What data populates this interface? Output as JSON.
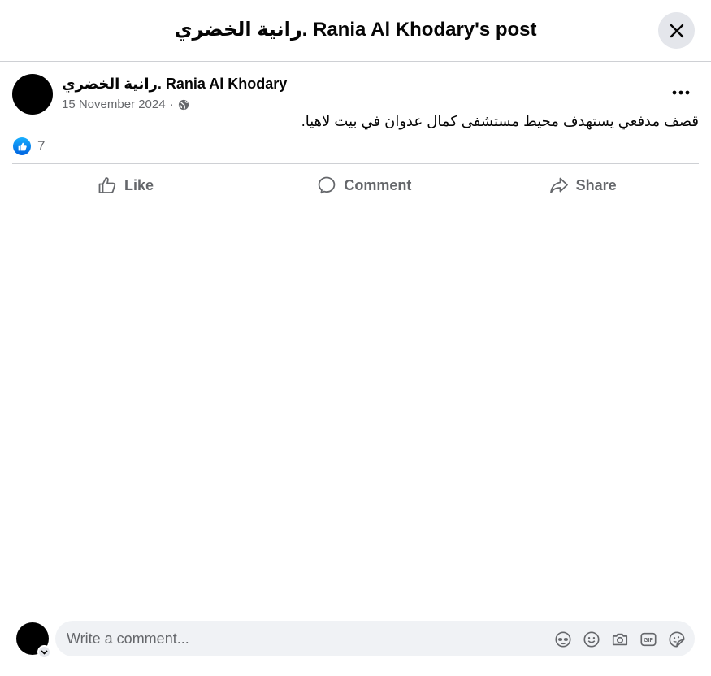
{
  "dialog": {
    "title": "رانية الخضري. Rania Al Khodary's post"
  },
  "post": {
    "author": "رانية الخضري. Rania Al Khodary",
    "date": "15 November 2024",
    "separator": "·",
    "privacy_icon": "globe-icon",
    "text": "قصف مدفعي يستهدف محيط مستشفى كمال عدوان في بيت لاهيا."
  },
  "reactions": {
    "icon": "like-reaction-icon",
    "count": "7"
  },
  "actions": {
    "like_label": "Like",
    "comment_label": "Comment",
    "share_label": "Share"
  },
  "composer": {
    "placeholder": "Write a comment...",
    "tools": [
      "avatar-sticker-icon",
      "emoji-icon",
      "camera-icon",
      "gif-icon",
      "sticker-icon"
    ]
  },
  "colors": {
    "accent": "#0866ff",
    "muted_text": "#65676b",
    "divider": "#ced0d4",
    "input_bg": "#f0f2f5"
  }
}
